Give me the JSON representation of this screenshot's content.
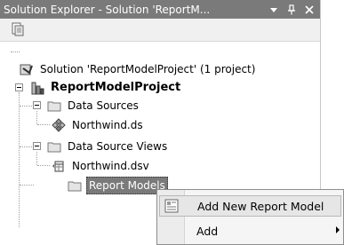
{
  "window": {
    "title": "Solution Explorer - Solution 'ReportM...",
    "dropdown_icon": "dropdown-arrow-icon",
    "pin_icon": "pin-icon",
    "close_icon": "close-icon"
  },
  "toolbar": {
    "properties_icon": "properties-icon"
  },
  "tree": {
    "solution": {
      "label": "Solution 'ReportModelProject' (1 project)",
      "icon": "solution-icon"
    },
    "project": {
      "label": "ReportModelProject",
      "icon": "report-model-project-icon",
      "expanded": true
    },
    "folders": [
      {
        "label": "Data Sources",
        "icon": "folder-icon",
        "expanded": true,
        "children": [
          {
            "label": "Northwind.ds",
            "icon": "data-source-icon"
          }
        ]
      },
      {
        "label": "Data Source Views",
        "icon": "folder-icon",
        "expanded": true,
        "children": [
          {
            "label": "Northwind.dsv",
            "icon": "data-source-view-icon"
          }
        ]
      },
      {
        "label": "Report Models",
        "icon": "folder-icon",
        "selected": true,
        "children": []
      }
    ]
  },
  "context_menu": {
    "items": [
      {
        "label": "Add New Report Model",
        "icon": "report-model-icon",
        "highlighted": true
      },
      {
        "label": "Add",
        "has_submenu": true
      }
    ]
  },
  "colors": {
    "title_bar": "#7a7a7a",
    "selection": "#7a7a7a",
    "menu_background": "#f5f5f5"
  }
}
